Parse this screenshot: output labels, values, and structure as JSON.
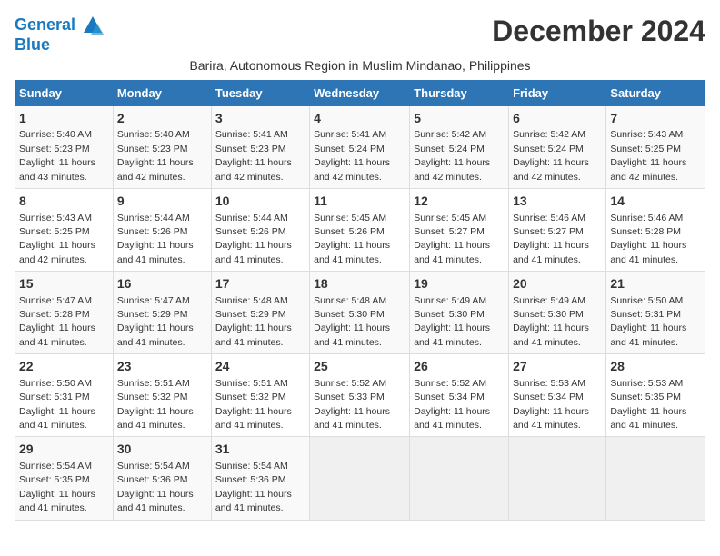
{
  "logo": {
    "line1": "General",
    "line2": "Blue"
  },
  "title": "December 2024",
  "subtitle": "Barira, Autonomous Region in Muslim Mindanao, Philippines",
  "days_of_week": [
    "Sunday",
    "Monday",
    "Tuesday",
    "Wednesday",
    "Thursday",
    "Friday",
    "Saturday"
  ],
  "weeks": [
    [
      {
        "day": "1",
        "info": "Sunrise: 5:40 AM\nSunset: 5:23 PM\nDaylight: 11 hours\nand 43 minutes."
      },
      {
        "day": "2",
        "info": "Sunrise: 5:40 AM\nSunset: 5:23 PM\nDaylight: 11 hours\nand 42 minutes."
      },
      {
        "day": "3",
        "info": "Sunrise: 5:41 AM\nSunset: 5:23 PM\nDaylight: 11 hours\nand 42 minutes."
      },
      {
        "day": "4",
        "info": "Sunrise: 5:41 AM\nSunset: 5:24 PM\nDaylight: 11 hours\nand 42 minutes."
      },
      {
        "day": "5",
        "info": "Sunrise: 5:42 AM\nSunset: 5:24 PM\nDaylight: 11 hours\nand 42 minutes."
      },
      {
        "day": "6",
        "info": "Sunrise: 5:42 AM\nSunset: 5:24 PM\nDaylight: 11 hours\nand 42 minutes."
      },
      {
        "day": "7",
        "info": "Sunrise: 5:43 AM\nSunset: 5:25 PM\nDaylight: 11 hours\nand 42 minutes."
      }
    ],
    [
      {
        "day": "8",
        "info": "Sunrise: 5:43 AM\nSunset: 5:25 PM\nDaylight: 11 hours\nand 42 minutes."
      },
      {
        "day": "9",
        "info": "Sunrise: 5:44 AM\nSunset: 5:26 PM\nDaylight: 11 hours\nand 41 minutes."
      },
      {
        "day": "10",
        "info": "Sunrise: 5:44 AM\nSunset: 5:26 PM\nDaylight: 11 hours\nand 41 minutes."
      },
      {
        "day": "11",
        "info": "Sunrise: 5:45 AM\nSunset: 5:26 PM\nDaylight: 11 hours\nand 41 minutes."
      },
      {
        "day": "12",
        "info": "Sunrise: 5:45 AM\nSunset: 5:27 PM\nDaylight: 11 hours\nand 41 minutes."
      },
      {
        "day": "13",
        "info": "Sunrise: 5:46 AM\nSunset: 5:27 PM\nDaylight: 11 hours\nand 41 minutes."
      },
      {
        "day": "14",
        "info": "Sunrise: 5:46 AM\nSunset: 5:28 PM\nDaylight: 11 hours\nand 41 minutes."
      }
    ],
    [
      {
        "day": "15",
        "info": "Sunrise: 5:47 AM\nSunset: 5:28 PM\nDaylight: 11 hours\nand 41 minutes."
      },
      {
        "day": "16",
        "info": "Sunrise: 5:47 AM\nSunset: 5:29 PM\nDaylight: 11 hours\nand 41 minutes."
      },
      {
        "day": "17",
        "info": "Sunrise: 5:48 AM\nSunset: 5:29 PM\nDaylight: 11 hours\nand 41 minutes."
      },
      {
        "day": "18",
        "info": "Sunrise: 5:48 AM\nSunset: 5:30 PM\nDaylight: 11 hours\nand 41 minutes."
      },
      {
        "day": "19",
        "info": "Sunrise: 5:49 AM\nSunset: 5:30 PM\nDaylight: 11 hours\nand 41 minutes."
      },
      {
        "day": "20",
        "info": "Sunrise: 5:49 AM\nSunset: 5:30 PM\nDaylight: 11 hours\nand 41 minutes."
      },
      {
        "day": "21",
        "info": "Sunrise: 5:50 AM\nSunset: 5:31 PM\nDaylight: 11 hours\nand 41 minutes."
      }
    ],
    [
      {
        "day": "22",
        "info": "Sunrise: 5:50 AM\nSunset: 5:31 PM\nDaylight: 11 hours\nand 41 minutes."
      },
      {
        "day": "23",
        "info": "Sunrise: 5:51 AM\nSunset: 5:32 PM\nDaylight: 11 hours\nand 41 minutes."
      },
      {
        "day": "24",
        "info": "Sunrise: 5:51 AM\nSunset: 5:32 PM\nDaylight: 11 hours\nand 41 minutes."
      },
      {
        "day": "25",
        "info": "Sunrise: 5:52 AM\nSunset: 5:33 PM\nDaylight: 11 hours\nand 41 minutes."
      },
      {
        "day": "26",
        "info": "Sunrise: 5:52 AM\nSunset: 5:34 PM\nDaylight: 11 hours\nand 41 minutes."
      },
      {
        "day": "27",
        "info": "Sunrise: 5:53 AM\nSunset: 5:34 PM\nDaylight: 11 hours\nand 41 minutes."
      },
      {
        "day": "28",
        "info": "Sunrise: 5:53 AM\nSunset: 5:35 PM\nDaylight: 11 hours\nand 41 minutes."
      }
    ],
    [
      {
        "day": "29",
        "info": "Sunrise: 5:54 AM\nSunset: 5:35 PM\nDaylight: 11 hours\nand 41 minutes."
      },
      {
        "day": "30",
        "info": "Sunrise: 5:54 AM\nSunset: 5:36 PM\nDaylight: 11 hours\nand 41 minutes."
      },
      {
        "day": "31",
        "info": "Sunrise: 5:54 AM\nSunset: 5:36 PM\nDaylight: 11 hours\nand 41 minutes."
      },
      null,
      null,
      null,
      null
    ]
  ]
}
